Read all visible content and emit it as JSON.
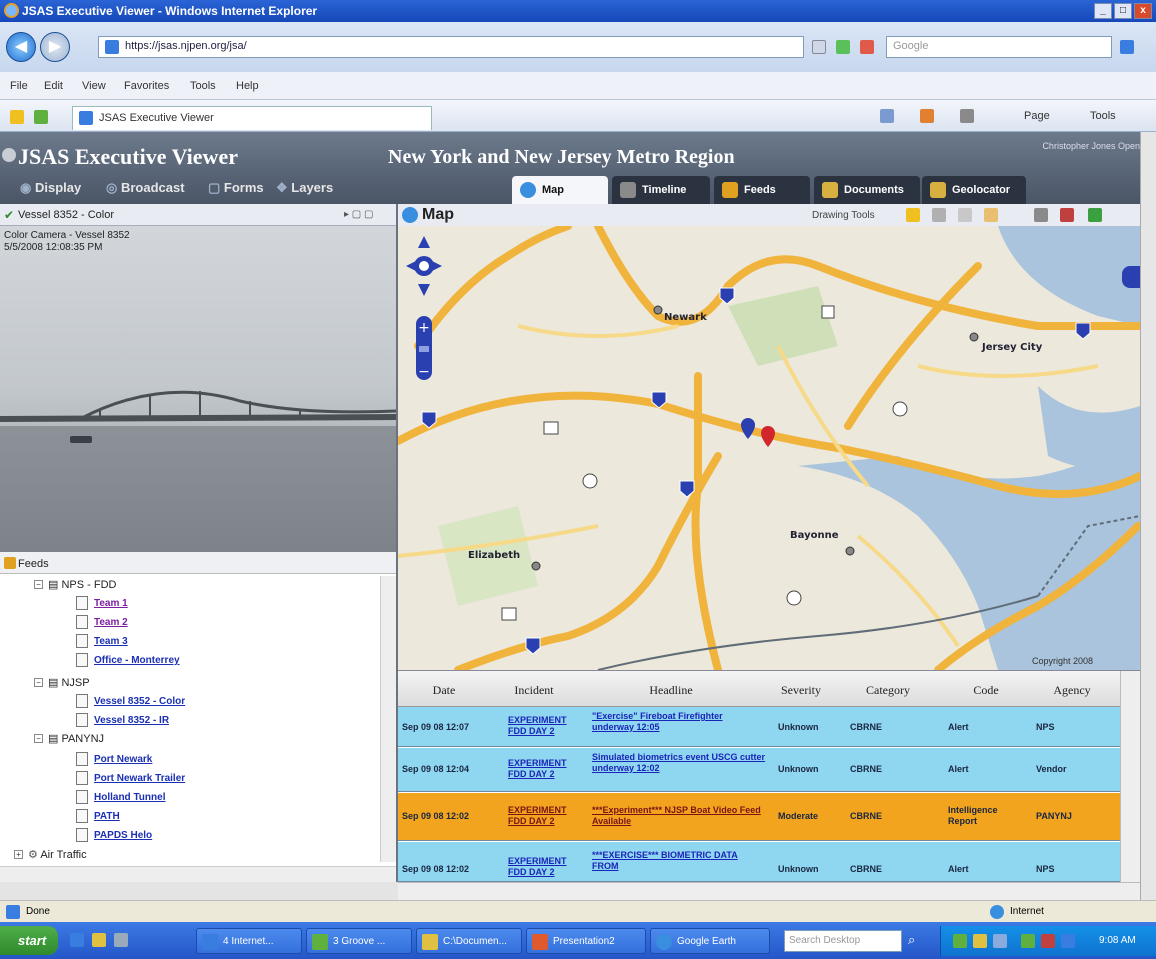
{
  "browser": {
    "window_title": "JSAS Executive Viewer - Windows Internet Explorer",
    "url": "https://jsas.njpen.org/jsa/",
    "search_placeholder": "Google",
    "menu": [
      "File",
      "Edit",
      "View",
      "Favorites",
      "Tools",
      "Help"
    ],
    "tab_title": "JSAS Executive Viewer",
    "commands": [
      "Page",
      "Tools"
    ],
    "status_left": "Done",
    "status_zone": "Internet"
  },
  "app": {
    "title": "JSAS Executive Viewer",
    "region_title": "New York and New Jersey Metro Region",
    "user": "Christopher Jones Open",
    "menu": [
      "Display",
      "Broadcast",
      "Forms",
      "Layers"
    ],
    "tabs": [
      {
        "label": "Map",
        "active": true
      },
      {
        "label": "Timeline",
        "active": false
      },
      {
        "label": "Feeds",
        "active": false
      },
      {
        "label": "Documents",
        "active": false
      },
      {
        "label": "Geolocator",
        "active": false
      }
    ]
  },
  "camera": {
    "title": "Vessel 8352 - Color",
    "caption_line1": "Color Camera - Vessel 8352",
    "caption_line2": "5/5/2008 12:08:35 PM"
  },
  "feeds": {
    "title": "Feeds",
    "groups": [
      {
        "name": "NPS - FDD",
        "items": [
          "Team 1",
          "Team 2",
          "Team 3",
          "Office - Monterrey"
        ]
      },
      {
        "name": "NJSP",
        "items": [
          "Vessel 8352 - Color",
          "Vessel 8352 - IR"
        ]
      },
      {
        "name": "PANYNJ",
        "items": [
          "Port Newark",
          "Port Newark Trailer",
          "Holland Tunnel",
          "PATH",
          "PAPDS Helo"
        ]
      }
    ],
    "extra": [
      "Air Traffic"
    ]
  },
  "map": {
    "title": "Map",
    "drawing_tools_label": "Drawing Tools",
    "labels": [
      "Newark",
      "Jersey City",
      "Elizabeth",
      "Bayonne"
    ],
    "attribution": "Copyright 2008",
    "markers": [
      {
        "name": "blue-pin",
        "color": "#2b3fb0"
      },
      {
        "name": "red-pin",
        "color": "#d0262c"
      }
    ]
  },
  "grid": {
    "columns": [
      "Date",
      "Incident",
      "Headline",
      "Severity",
      "Category",
      "Code",
      "Agency"
    ],
    "rows": [
      {
        "date": "Sep 09 08 12:07",
        "incident": "EXPERIMENT FDD DAY 2",
        "headline": "\"Exercise\" Fireboat Firefighter underway 12:05",
        "severity": "Unknown",
        "category": "CBRNE",
        "code": "Alert",
        "agency": "NPS",
        "color": "#8fd7f0"
      },
      {
        "date": "Sep 09 08 12:04",
        "incident": "EXPERIMENT FDD DAY 2",
        "headline": "Simulated biometrics event USCG cutter underway 12:02",
        "severity": "Unknown",
        "category": "CBRNE",
        "code": "Alert",
        "agency": "Vendor",
        "color": "#8fd7f0"
      },
      {
        "date": "Sep 09 08 12:02",
        "incident": "EXPERIMENT FDD DAY 2",
        "headline": "***Experiment*** NJSP Boat Video Feed Available",
        "severity": "Moderate",
        "category": "CBRNE",
        "code": "Intelligence Report",
        "agency": "PANYNJ",
        "color": "#f2a41e"
      },
      {
        "date": "Sep 09 08 12:02",
        "incident": "EXPERIMENT FDD DAY 2",
        "headline": "***EXERCISE*** BIOMETRIC DATA FROM",
        "severity": "Unknown",
        "category": "CBRNE",
        "code": "Alert",
        "agency": "NPS",
        "color": "#8fd7f0"
      }
    ]
  },
  "taskbar": {
    "start": "start",
    "tasks": [
      "4 Internet...",
      "3 Groove ...",
      "C:\\Documen...",
      "Presentation2",
      "Google Earth"
    ],
    "search_placeholder": "Search Desktop",
    "clock": "9:08 AM"
  },
  "colors": {
    "accent": "#1648b8",
    "row_alert": "#8fd7f0",
    "row_highlight": "#f2a41e"
  }
}
